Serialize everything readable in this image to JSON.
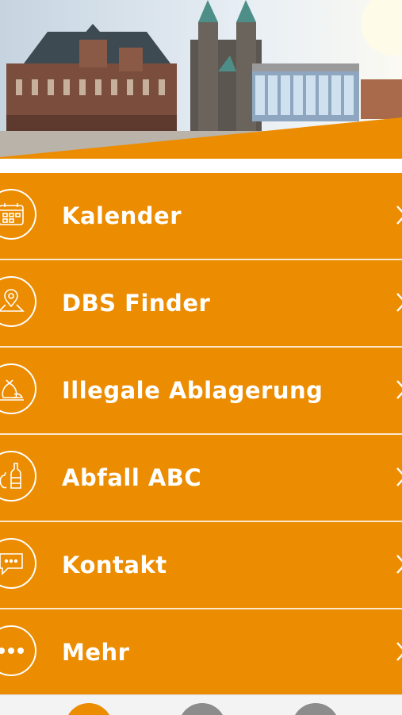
{
  "theme": {
    "accent": "#ec8c00",
    "divider": "#ffffff",
    "tab_active": "#ec8c00",
    "tab_inactive": "#8c8c8c"
  },
  "menu": {
    "items": [
      {
        "label": "Kalender",
        "icon": "calendar-icon"
      },
      {
        "label": "DBS Finder",
        "icon": "map-pin-icon"
      },
      {
        "label": "Illegale Ablagerung",
        "icon": "garbage-bag-icon"
      },
      {
        "label": "Abfall ABC",
        "icon": "bottle-apple-icon"
      },
      {
        "label": "Kontakt",
        "icon": "chat-bubble-icon"
      },
      {
        "label": "Mehr",
        "icon": "more-dots-icon"
      }
    ]
  },
  "tabbar": {
    "tabs": [
      {
        "icon": "home-tab-icon",
        "active": true
      },
      {
        "icon": "calendar-tab-icon",
        "active": false
      },
      {
        "icon": "settings-tab-icon",
        "active": false
      }
    ]
  }
}
